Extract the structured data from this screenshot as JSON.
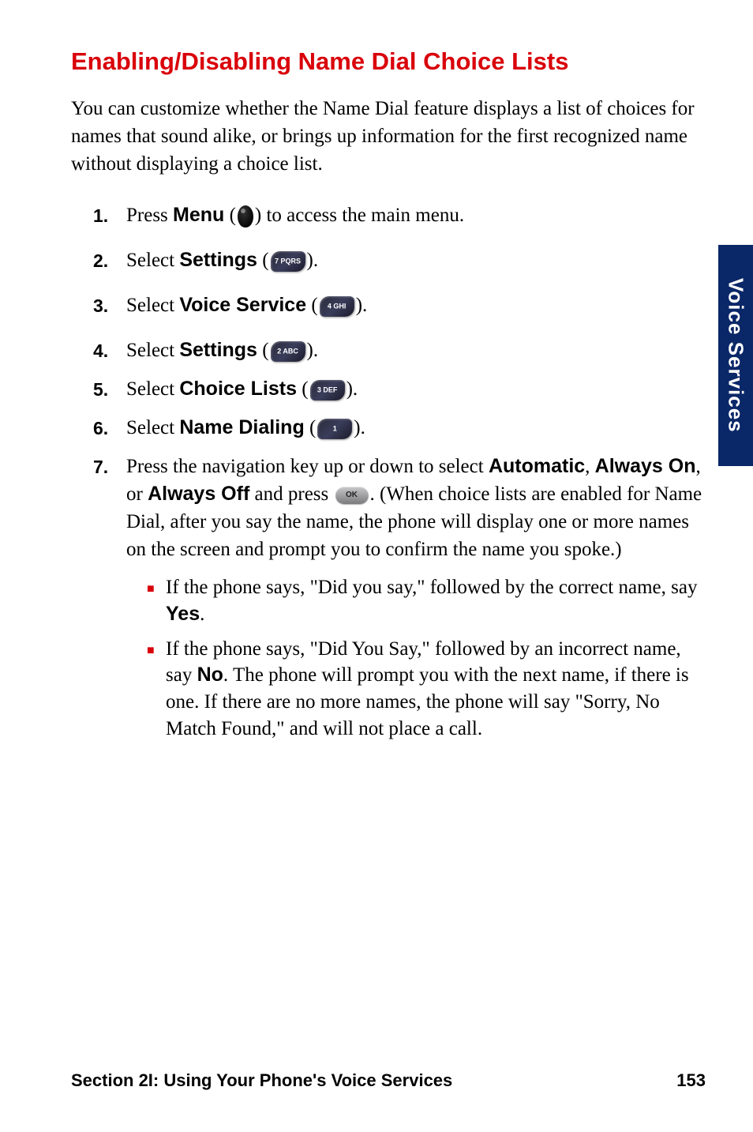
{
  "title": "Enabling/Disabling Name Dial Choice Lists",
  "intro": "You can customize whether the Name Dial feature displays a list of choices for names that sound alike, or brings up information for the first recognized name without displaying a choice list.",
  "steps": {
    "s1": {
      "num": "1.",
      "t1": "Press ",
      "bold": "Menu",
      "t2": " (",
      "t3": ") to access the main menu."
    },
    "s2": {
      "num": "2.",
      "t1": "Select ",
      "bold": "Settings",
      "t2": " (",
      "key": "7 PQRS",
      "t3": ")."
    },
    "s3": {
      "num": "3.",
      "t1": "Select ",
      "bold": "Voice Service",
      "t2": " (",
      "key": "4 GHI",
      "t3": ")."
    },
    "s4": {
      "num": "4.",
      "t1": "Select ",
      "bold": "Settings",
      "t2": " (",
      "key": "2 ABC",
      "t3": ")."
    },
    "s5": {
      "num": "5.",
      "t1": "Select ",
      "bold": "Choice Lists",
      "t2": " (",
      "key": "3 DEF",
      "t3": ")."
    },
    "s6": {
      "num": "6.",
      "t1": "Select ",
      "bold": "Name Dialing",
      "t2": " (",
      "key": "1",
      "t3": ")."
    },
    "s7": {
      "num": "7.",
      "t1": "Press the navigation key up or down to select ",
      "b1": "Automatic",
      "sep1": ", ",
      "b2": "Always On",
      "sep2": ", or ",
      "b3": "Always Off",
      "t2": " and press ",
      "ok": "OK",
      "t3": ". (When choice lists are enabled for Name Dial, after you say the name, the phone will display one or more names on the screen and prompt you to confirm the name you spoke.)",
      "bullets": {
        "b1": {
          "p1": "If the phone says, \"Did you say,\" followed by the correct name, say ",
          "bold": "Yes",
          "p2": "."
        },
        "b2": {
          "p1": "If the phone says, \"Did You Say,\" followed by an incorrect name, say ",
          "bold": "No",
          "p2": ". The phone will prompt you with the next name, if there is one. If there are no more names, the phone will say \"Sorry, No Match Found,\" and will not place a call."
        }
      }
    }
  },
  "side_tab": "Voice Services",
  "footer": {
    "section": "Section 2I: Using Your Phone's Voice Services",
    "page": "153"
  }
}
